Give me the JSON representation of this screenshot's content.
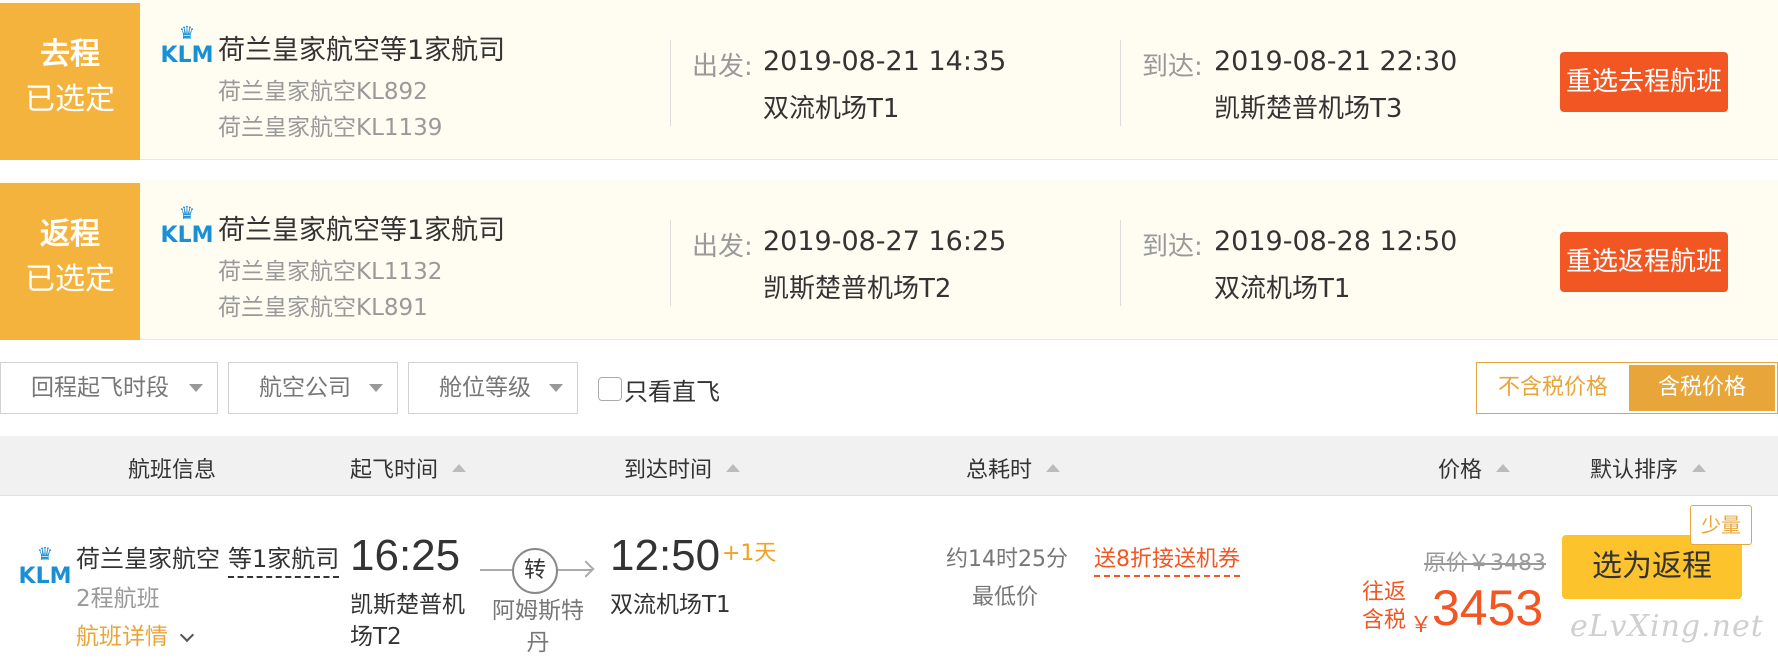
{
  "outbound": {
    "tag_line1": "去程",
    "tag_line2": "已选定",
    "logo_text": "KLM",
    "airline": "荷兰皇家航空等1家航司",
    "flight1": "荷兰皇家航空KL892",
    "flight2": "荷兰皇家航空KL1139",
    "depart_label": "出发:",
    "depart_datetime": "2019-08-21 14:35",
    "depart_airport": "双流机场T1",
    "arrive_label": "到达:",
    "arrive_datetime": "2019-08-21 22:30",
    "arrive_airport": "凯斯楚普机场T3",
    "reselect_label": "重选去程航班"
  },
  "return": {
    "tag_line1": "返程",
    "tag_line2": "已选定",
    "logo_text": "KLM",
    "airline": "荷兰皇家航空等1家航司",
    "flight1": "荷兰皇家航空KL1132",
    "flight2": "荷兰皇家航空KL891",
    "depart_label": "出发:",
    "depart_datetime": "2019-08-27 16:25",
    "depart_airport": "凯斯楚普机场T2",
    "arrive_label": "到达:",
    "arrive_datetime": "2019-08-28 12:50",
    "arrive_airport": "双流机场T1",
    "reselect_label": "重选返程航班"
  },
  "filters": {
    "departure_period": "回程起飞时段",
    "airline": "航空公司",
    "cabin_class": "舱位等级",
    "direct_only_label": "只看直飞",
    "direct_only_checked": false,
    "price_excl_tax": "不含税价格",
    "price_incl_tax": "含税价格",
    "selected_price_mode": "含税价格"
  },
  "sort_header": {
    "flight_info": "航班信息",
    "depart_time": "起飞时间",
    "arrive_time": "到达时间",
    "total_duration": "总耗时",
    "price": "价格",
    "default_sort": "默认排序"
  },
  "result": {
    "logo_text": "KLM",
    "airline": "荷兰皇家航空",
    "more_airlines": "等1家航司",
    "legs": "2程航班",
    "detail_link": "航班详情",
    "depart_time": "16:25",
    "depart_airport_line1": "凯斯楚普机",
    "depart_airport_line2": "场T2",
    "transfer_label": "转",
    "transfer_city_line1": "阿姆斯特",
    "transfer_city_line2": "丹",
    "arrive_time": "12:50",
    "plus_day": "+1天",
    "arrive_airport": "双流机场T1",
    "duration": "约14时25分",
    "lowest_tag": "最低价",
    "promo": "送8折接送机券",
    "original_price": "原价￥3483",
    "round_trip_line1": "往返",
    "round_trip_line2": "含税",
    "currency": "￥",
    "price": "3453",
    "choose_label": "选为返程",
    "few_seats_badge": "少量"
  },
  "watermark": "eLvXing.net",
  "colors": {
    "tag_bg": "#f4b33d",
    "reselect_bg": "#f25623",
    "price_red": "#f25623",
    "toggle_orange": "#e8a53a",
    "choose_btn": "#fcc32c",
    "klm_blue": "#1a8fd6"
  }
}
